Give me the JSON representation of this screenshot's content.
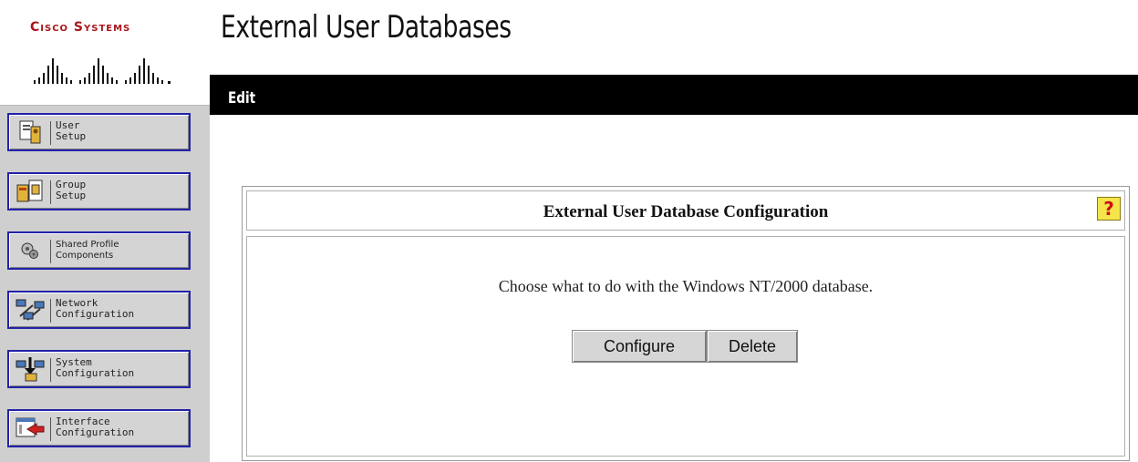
{
  "brand": {
    "name": "Cisco Systems",
    "color": "#a8161b"
  },
  "header": {
    "title": "External User Databases"
  },
  "edit_bar": {
    "label": "Edit"
  },
  "sidebar": {
    "items": [
      {
        "label": "User\nSetup",
        "icon": "user-setup-icon"
      },
      {
        "label": "Group\nSetup",
        "icon": "group-setup-icon"
      },
      {
        "label": "Shared Profile\nComponents",
        "icon": "shared-profile-icon"
      },
      {
        "label": "Network\nConfiguration",
        "icon": "network-config-icon"
      },
      {
        "label": "System\nConfiguration",
        "icon": "system-config-icon"
      },
      {
        "label": "Interface\nConfiguration",
        "icon": "interface-config-icon"
      }
    ]
  },
  "panel": {
    "title": "External User Database Configuration",
    "help": "?",
    "message": "Choose what to do with the Windows NT/2000 database.",
    "buttons": {
      "configure": "Configure",
      "delete": "Delete"
    }
  }
}
